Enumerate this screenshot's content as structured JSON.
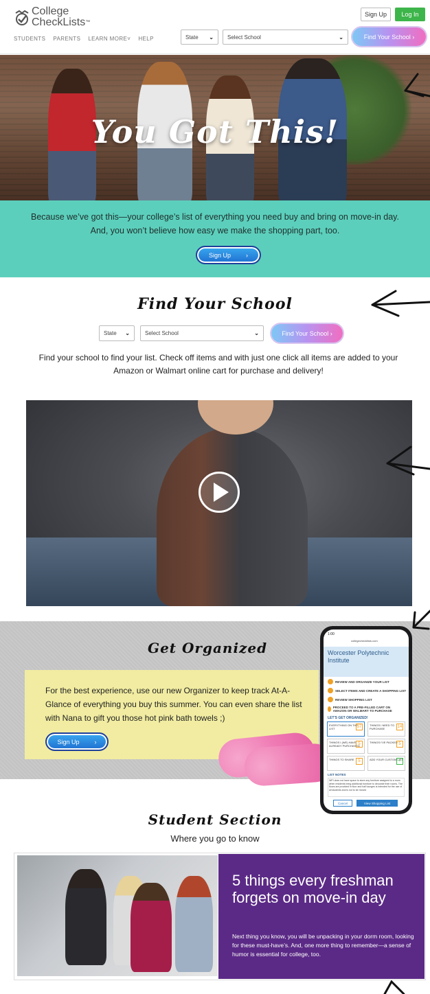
{
  "header": {
    "logo_line1": "College",
    "logo_line2": "CheckLists",
    "logo_tm": "™",
    "nav": [
      "STUDENTS",
      "PARENTS",
      "LEARN MORE",
      "HELP"
    ],
    "learn_more_caret": "˅",
    "sign_up": "Sign Up",
    "log_in": "Log In",
    "state_select": "State",
    "school_select": "Select School",
    "find_button": "Find Your School"
  },
  "hero": {
    "title": "You Got This!"
  },
  "teal": {
    "line1": "Because we’ve got this—your college’s list of everything you need buy and bring on move-in day.",
    "line2": "And, you won’t believe how easy we make the shopping part, too.",
    "button": "Sign Up"
  },
  "find_school": {
    "title": "Find Your School",
    "state_select": "State",
    "school_select": "Select School",
    "button": "Find Your School",
    "description": "Find your school to find your list. Check off items and with just one click all items are added to your Amazon or Walmart online cart for purchase and delivery!"
  },
  "organized": {
    "title": "Get Organized",
    "body": "For the best experience, use our new Organizer to keep track At-A-Glance of everything you buy this summer. You can even share the list with Nana to gift you those hot pink bath towels ;)",
    "button": "Sign Up"
  },
  "phone": {
    "time": "1:00",
    "url": "collegechecklists.com",
    "school": "Worcester Polytechnic Institute",
    "steps": [
      "REVIEW AND ORGANIZE YOUR LIST",
      "SELECT ITEMS AND CREATE A SHOPPING LIST",
      "REVIEW SHOPPING LIST",
      "PROCEED TO A PRE-FILLED CART ON AMAZON OR WALMART TO PURCHASE"
    ],
    "organized_heading": "LET'S GET ORGANIZED!",
    "cards": [
      {
        "label": "EVERYTHING ON THE LIST",
        "count": "37"
      },
      {
        "label": "THINGS I NEED TO PURCHASE",
        "count": "14"
      },
      {
        "label": "THINGS I (WE) HAVE ALREADY PURCHASED",
        "count": "5"
      },
      {
        "label": "THINGS I'VE PACKED",
        "count": "5"
      },
      {
        "label": "THINGS TO SHARE",
        "count": "5"
      },
      {
        "label": "ADD YOUR CUSTOM LIST",
        "count": "+"
      }
    ],
    "view_list": "VIEW LIST",
    "items_label": "ITEMS",
    "notes_heading": "LIST NOTES",
    "notes_text": "WPI does not have space to store any furniture assigned to a room when residents bring additional furniture to decorate their rooms. The floors are provided in floor and hall lounges is intended for the use of all students and is not to be moved",
    "cancel": "Cancel",
    "view_shopping": "View Shopping List"
  },
  "student": {
    "title": "Student Section",
    "subtitle": "Where you go to know",
    "card_title": "5 things every freshman forgets on move-in day",
    "card_body": "Next thing you know, you will be unpacking in your dorm room, looking for these must-have’s. And, one more thing to remember—a sense of humor is essential for college, too."
  },
  "colors": {
    "teal": "#5ccfbc",
    "purple": "#5b2a86",
    "yellow": "#f1eca1",
    "login_green": "#3db54a"
  }
}
